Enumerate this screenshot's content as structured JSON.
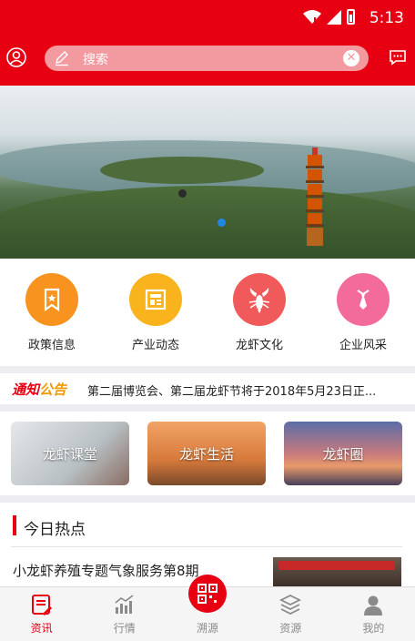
{
  "status_bar": {
    "time": "5:13"
  },
  "search": {
    "placeholder": "搜索"
  },
  "categories": [
    {
      "label": "政策信息",
      "color": "#f7931e"
    },
    {
      "label": "产业动态",
      "color": "#f9b31c"
    },
    {
      "label": "龙虾文化",
      "color": "#f15a5a"
    },
    {
      "label": "企业风采",
      "color": "#f36b9b"
    }
  ],
  "notice": {
    "tag_part1": "通知",
    "tag_part2": "公告",
    "text": "第二届博览会、第二届龙虾节将于2018年5月23日正..."
  },
  "cards": [
    {
      "label": "龙虾课堂"
    },
    {
      "label": "龙虾生活"
    },
    {
      "label": "龙虾圈"
    }
  ],
  "hot": {
    "title": "今日热点",
    "headline": "小龙虾养殖专题气象服务第8期"
  },
  "tabs": [
    {
      "label": "资讯"
    },
    {
      "label": "行情"
    },
    {
      "label": "溯源"
    },
    {
      "label": "资源"
    },
    {
      "label": "我的"
    }
  ],
  "colors": {
    "brand": "#e60012",
    "tab_inactive": "#8a8a8a"
  }
}
